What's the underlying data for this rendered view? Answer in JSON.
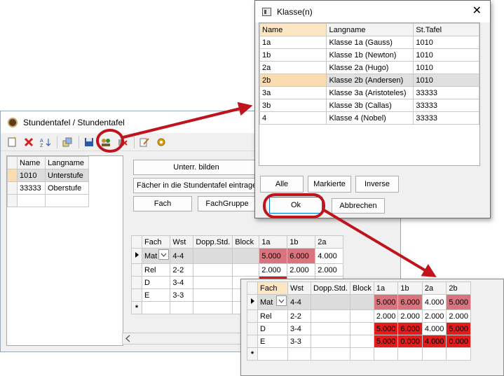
{
  "main_window": {
    "title": "Stundentafel / Stundentafel",
    "left_grid": {
      "headers": [
        "Name",
        "Langname"
      ],
      "rows": [
        {
          "name": "1010",
          "langname": "Unterstufe"
        },
        {
          "name": "33333",
          "langname": "Oberstufe"
        }
      ]
    },
    "buttons": {
      "unterr_bilden": "Unterr. bilden",
      "faecher_eintragen": "Fächer in die Stundentafel eintragen",
      "fach": "Fach",
      "fachgruppe": "FachGruppe"
    },
    "fach_grid": {
      "headers": [
        "Fach",
        "Wst",
        "Dopp.Std.",
        "Block",
        "1a",
        "1b",
        "2a"
      ],
      "rows": [
        {
          "fach": "Mat",
          "wst": "4-4",
          "c1a": "5.000",
          "c1b": "6.000",
          "c2a": "4.000"
        },
        {
          "fach": "Rel",
          "wst": "2-2",
          "c1a": "2.000",
          "c1b": "2.000",
          "c2a": "2.000"
        },
        {
          "fach": "D",
          "wst": "3-4",
          "c1a": "",
          "c1b": "",
          "c2a": ""
        },
        {
          "fach": "E",
          "wst": "3-3",
          "c1a": "",
          "c1b": "",
          "c2a": ""
        }
      ],
      "new_row_marker": "*"
    }
  },
  "dialog": {
    "title": "Klasse(n)",
    "close_glyph": "✕",
    "headers": [
      "Name",
      "Langname",
      "St.Tafel"
    ],
    "rows": [
      {
        "name": "1a",
        "langname": "Klasse 1a (Gauss)",
        "tafel": "1010"
      },
      {
        "name": "1b",
        "langname": "Klasse 1b (Newton)",
        "tafel": "1010"
      },
      {
        "name": "2a",
        "langname": "Klasse 2a (Hugo)",
        "tafel": "1010"
      },
      {
        "name": "2b",
        "langname": "Klasse 2b (Andersen)",
        "tafel": "1010"
      },
      {
        "name": "3a",
        "langname": "Klasse 3a (Aristoteles)",
        "tafel": "33333"
      },
      {
        "name": "3b",
        "langname": "Klasse 3b (Callas)",
        "tafel": "33333"
      },
      {
        "name": "4",
        "langname": "Klasse 4 (Nobel)",
        "tafel": "33333"
      }
    ],
    "selected_row": "2b",
    "buttons": {
      "alle": "Alle",
      "markierte": "Markierte",
      "inverse": "Inverse",
      "ok": "Ok",
      "abbrechen": "Abbrechen"
    }
  },
  "zoom_grid": {
    "headers": [
      "Fach",
      "Wst",
      "Dopp.Std.",
      "Block",
      "1a",
      "1b",
      "2a",
      "2b"
    ],
    "rows": [
      {
        "fach": "Mat",
        "wst": "4-4",
        "c1a": "5.000",
        "c1b": "6.000",
        "c2a": "4.000",
        "c2b": "5.000"
      },
      {
        "fach": "Rel",
        "wst": "2-2",
        "c1a": "2.000",
        "c1b": "2.000",
        "c2a": "2.000",
        "c2b": "2.000"
      },
      {
        "fach": "D",
        "wst": "3-4",
        "c1a": "5.000",
        "c1b": "6.000",
        "c2a": "4.000",
        "c2b": "5.000"
      },
      {
        "fach": "E",
        "wst": "3-3",
        "c1a": "5.000",
        "c1b": "0.000",
        "c2a": "4.000",
        "c2b": "0.000"
      }
    ],
    "new_row_marker": "*"
  },
  "colors": {
    "annotation_red": "#c0141d",
    "cell_pink": "#d9737e",
    "cell_red": "#e41b1b",
    "selected_row": "#f9dcb2"
  },
  "icons": [
    "new-icon",
    "delete-icon",
    "sort-icon",
    "copy-icon",
    "save-icon",
    "assign-classes-icon",
    "remove-icon",
    "edit-icon",
    "settings-icon",
    "row-pointer-icon",
    "dropdown-icon"
  ]
}
